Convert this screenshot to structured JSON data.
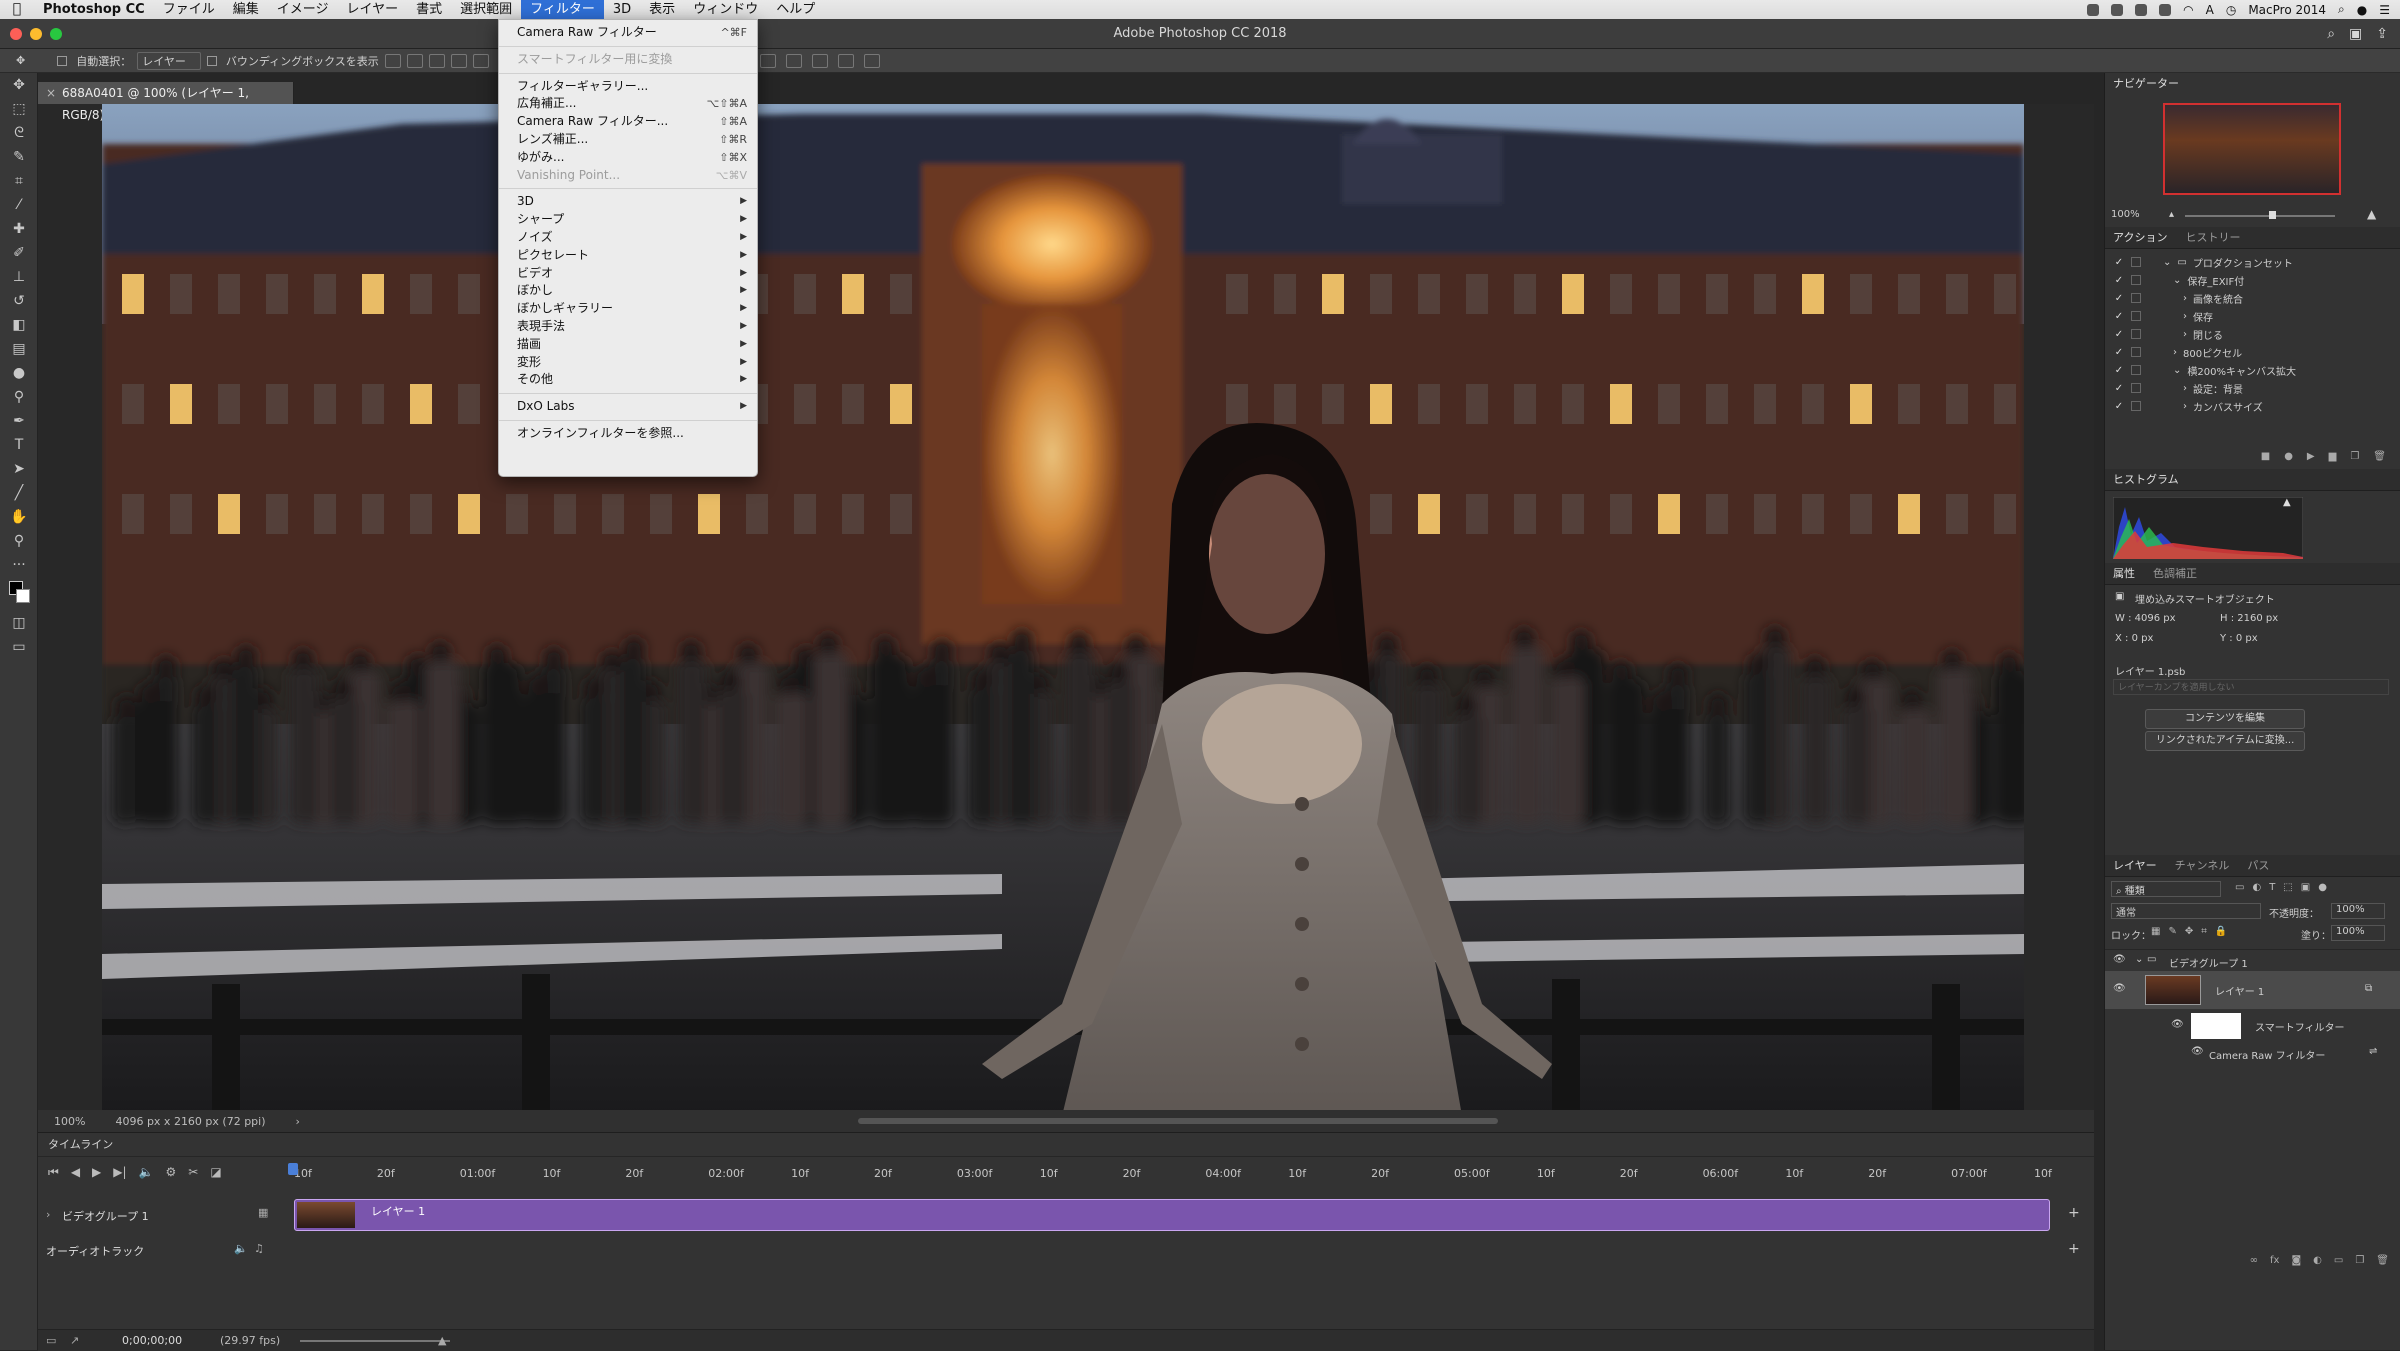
{
  "menubar": {
    "app": "Photoshop CC",
    "items": [
      "ファイル",
      "編集",
      "イメージ",
      "レイヤー",
      "書式",
      "選択範囲",
      "フィルター",
      "3D",
      "表示",
      "ウィンドウ",
      "ヘルプ"
    ],
    "active_index": 6,
    "computer_name": "MacPro 2014"
  },
  "window": {
    "title": "Adobe Photoshop CC 2018"
  },
  "options_bar": {
    "auto_select_label": "自動選択：",
    "auto_select_value": "レイヤー",
    "bbox_label": "バウンディングボックスを表示"
  },
  "doc_tab": {
    "title": "688A0401 @ 100% (レイヤー 1, RGB/8) *"
  },
  "status": {
    "zoom": "100%",
    "doc_info": "4096 px x 2160 px (72 ppi)"
  },
  "filter_menu": {
    "items": [
      {
        "label": "Camera Raw フィルター",
        "shortcut": "^⌘F",
        "disabled": false,
        "submenu": false
      },
      {
        "sep": true
      },
      {
        "label": "スマートフィルター用に変換",
        "shortcut": "",
        "disabled": true,
        "submenu": false
      },
      {
        "sep": true
      },
      {
        "label": "フィルターギャラリー...",
        "shortcut": "",
        "disabled": false,
        "submenu": false
      },
      {
        "label": "広角補正...",
        "shortcut": "⌥⇧⌘A",
        "disabled": false,
        "submenu": false
      },
      {
        "label": "Camera Raw フィルター...",
        "shortcut": "⇧⌘A",
        "disabled": false,
        "submenu": false
      },
      {
        "label": "レンズ補正...",
        "shortcut": "⇧⌘R",
        "disabled": false,
        "submenu": false
      },
      {
        "label": "ゆがみ...",
        "shortcut": "⇧⌘X",
        "disabled": false,
        "submenu": false
      },
      {
        "label": "Vanishing Point...",
        "shortcut": "⌥⌘V",
        "disabled": true,
        "submenu": false
      },
      {
        "sep": true
      },
      {
        "label": "3D",
        "shortcut": "",
        "disabled": false,
        "submenu": true
      },
      {
        "label": "シャープ",
        "shortcut": "",
        "disabled": false,
        "submenu": true
      },
      {
        "label": "ノイズ",
        "shortcut": "",
        "disabled": false,
        "submenu": true
      },
      {
        "label": "ピクセレート",
        "shortcut": "",
        "disabled": false,
        "submenu": true
      },
      {
        "label": "ビデオ",
        "shortcut": "",
        "disabled": false,
        "submenu": true
      },
      {
        "label": "ぼかし",
        "shortcut": "",
        "disabled": false,
        "submenu": true
      },
      {
        "label": "ぼかしギャラリー",
        "shortcut": "",
        "disabled": false,
        "submenu": true
      },
      {
        "label": "表現手法",
        "shortcut": "",
        "disabled": false,
        "submenu": true
      },
      {
        "label": "描画",
        "shortcut": "",
        "disabled": false,
        "submenu": true
      },
      {
        "label": "変形",
        "shortcut": "",
        "disabled": false,
        "submenu": true
      },
      {
        "label": "その他",
        "shortcut": "",
        "disabled": false,
        "submenu": true
      },
      {
        "sep": true
      },
      {
        "label": "DxO Labs",
        "shortcut": "",
        "disabled": false,
        "submenu": true
      },
      {
        "sep": true
      },
      {
        "label": "オンラインフィルターを参照...",
        "shortcut": "",
        "disabled": false,
        "submenu": false
      }
    ]
  },
  "navigator": {
    "tab": "ナビゲーター",
    "zoom": "100%"
  },
  "actions": {
    "tabs": [
      "アクション",
      "ヒストリー"
    ],
    "rows": [
      {
        "label": "プロダクションセット",
        "indent": 1,
        "expanded": true,
        "folder": true
      },
      {
        "label": "保存_EXIF付",
        "indent": 2,
        "expanded": true,
        "folder": false
      },
      {
        "label": "画像を統合",
        "indent": 3,
        "expanded": false,
        "folder": false
      },
      {
        "label": "保存",
        "indent": 3,
        "expanded": false,
        "folder": false
      },
      {
        "label": "閉じる",
        "indent": 3,
        "expanded": false,
        "folder": false
      },
      {
        "label": "800ピクセル",
        "indent": 2,
        "expanded": false,
        "folder": false
      },
      {
        "label": "横200%キャンバス拡大",
        "indent": 2,
        "expanded": true,
        "folder": false
      },
      {
        "label": "設定：背景",
        "indent": 3,
        "expanded": false,
        "folder": false
      },
      {
        "label": "カンバスサイズ",
        "indent": 3,
        "expanded": false,
        "folder": false
      }
    ]
  },
  "histogram": {
    "tab": "ヒストグラム"
  },
  "properties": {
    "tabs": [
      "属性",
      "色調補正"
    ],
    "kind": "埋め込みスマートオブジェクト",
    "w": "W : 4096 px",
    "h": "H : 2160 px",
    "x": "X : 0 px",
    "y": "Y : 0 px",
    "file": "レイヤー 1.psb",
    "comp_placeholder": "レイヤーカンプを適用しない",
    "btn_edit": "コンテンツを編集",
    "btn_convert": "リンクされたアイテムに変換..."
  },
  "layers": {
    "tabs": [
      "レイヤー",
      "チャンネル",
      "パス"
    ],
    "filter": "種類",
    "blend": "通常",
    "opacity_label": "不透明度：",
    "opacity": "100%",
    "lock_label": "ロック：",
    "fill_label": "塗り：",
    "fill": "100%",
    "group": "ビデオグループ 1",
    "layer": "レイヤー 1",
    "smart_filter": "スマートフィルター",
    "camera_raw": "Camera Raw フィルター"
  },
  "timeline": {
    "title": "タイムライン",
    "ruler": [
      "10f",
      "20f",
      "01:00f",
      "10f",
      "20f",
      "02:00f",
      "10f",
      "20f",
      "03:00f",
      "10f",
      "20f",
      "04:00f",
      "10f",
      "20f",
      "05:00f",
      "10f",
      "20f",
      "06:00f",
      "10f",
      "20f",
      "07:00f",
      "10f"
    ],
    "video_track": "ビデオグループ 1",
    "clip": "レイヤー 1",
    "audio_track": "オーディオトラック",
    "timecode": "0;00;00;00",
    "fps": "(29.97 fps)"
  }
}
